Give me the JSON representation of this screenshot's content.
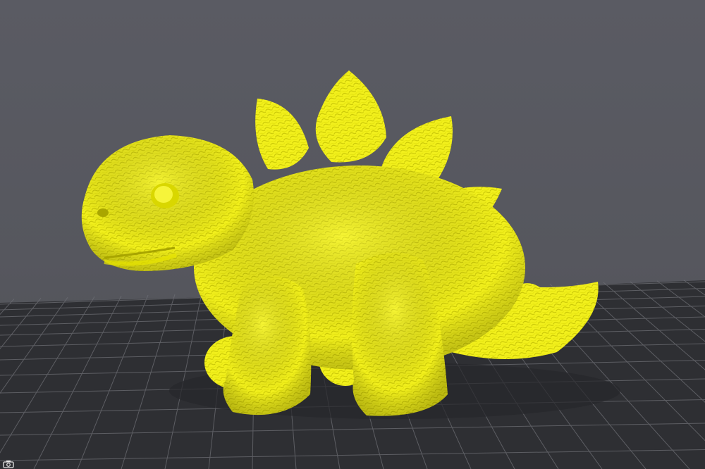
{
  "viewport": {
    "background_color": "#595a61",
    "bed_color": "#2f3034",
    "grid_color": "#6e6f75",
    "model_color": "#f1ef1b",
    "model_shadow_color": "#b5b300",
    "model_name": "",
    "corner_icon": "camera-icon"
  }
}
